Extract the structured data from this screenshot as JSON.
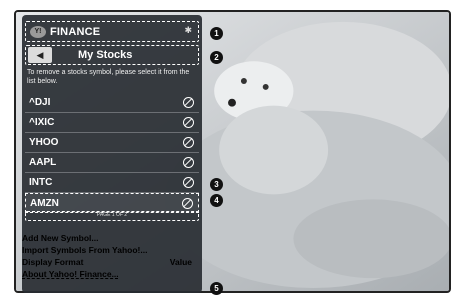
{
  "header": {
    "title": "FINANCE",
    "logo_text": "Y!",
    "pin_icon": "pin-icon"
  },
  "subheader": {
    "back_label": "◀",
    "title": "My Stocks"
  },
  "hint": "To remove a stocks symbol, please select it from the list below.",
  "stocks": [
    {
      "symbol": "^DJI"
    },
    {
      "symbol": "^IXIC"
    },
    {
      "symbol": "YHOO"
    },
    {
      "symbol": "AAPL"
    },
    {
      "symbol": "INTC"
    },
    {
      "symbol": "AMZN",
      "selected": true
    }
  ],
  "pager": "PAGE 1 OF 2",
  "menu": [
    {
      "label": "Add New Symbol...",
      "value": ""
    },
    {
      "label": "Import Symbols From Yahoo!...",
      "value": ""
    },
    {
      "label": "Display Format",
      "value": "Value"
    },
    {
      "label": "About Yahoo! Finance...",
      "value": ""
    }
  ],
  "callouts": [
    "1",
    "2",
    "3",
    "4",
    "5"
  ],
  "colors": {
    "panel": "#2c3036",
    "border": "#ffffff"
  }
}
